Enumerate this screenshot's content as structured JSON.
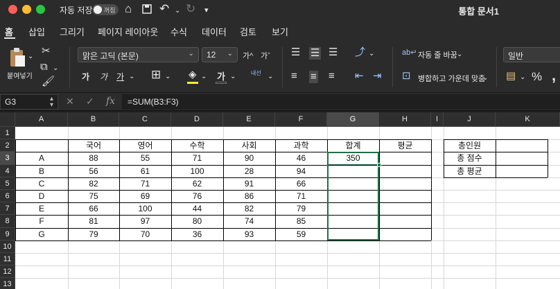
{
  "titlebar": {
    "autosave_label": "자동 저장",
    "autosave_state": "꺼짐",
    "doc_title": "통합 문서1"
  },
  "tabs": [
    "홈",
    "삽입",
    "그리기",
    "페이지 레이아웃",
    "수식",
    "데이터",
    "검토",
    "보기"
  ],
  "ribbon": {
    "paste_label": "붙여넣기",
    "font_name": "맑은 고딕 (본문)",
    "font_size": "12",
    "bold": "가",
    "italic": "가",
    "underline": "가",
    "font_color_glyph": "가",
    "grow_font": "가^",
    "shrink_font": "가ˇ",
    "rtl_label": "내선",
    "wrap_text": "자동 줄 바꿈",
    "merge_center": "병합하고 가운데 맞춤",
    "number_format": "일반",
    "percent": "%"
  },
  "formula_bar": {
    "name_box": "G3",
    "fx": "fx",
    "formula": "=SUM(B3:F3)"
  },
  "sheet": {
    "columns": [
      "A",
      "B",
      "C",
      "D",
      "E",
      "F",
      "G",
      "H",
      "I",
      "J",
      "K"
    ],
    "rows": [
      "1",
      "2",
      "3",
      "4",
      "5",
      "6",
      "7",
      "8",
      "9",
      "10",
      "11",
      "12",
      "13"
    ],
    "selected_column": "G",
    "selected_row": "3",
    "header_row": [
      "",
      "국어",
      "영어",
      "수학",
      "사회",
      "과학",
      "합계",
      "평균"
    ],
    "data": [
      [
        "A",
        "88",
        "55",
        "71",
        "90",
        "46",
        "350",
        ""
      ],
      [
        "B",
        "56",
        "61",
        "100",
        "28",
        "94",
        "",
        ""
      ],
      [
        "C",
        "82",
        "71",
        "62",
        "91",
        "66",
        "",
        ""
      ],
      [
        "D",
        "75",
        "69",
        "76",
        "86",
        "71",
        "",
        ""
      ],
      [
        "E",
        "66",
        "100",
        "44",
        "82",
        "79",
        "",
        ""
      ],
      [
        "F",
        "81",
        "97",
        "80",
        "74",
        "85",
        "",
        ""
      ],
      [
        "G",
        "79",
        "70",
        "36",
        "93",
        "59",
        "",
        ""
      ]
    ],
    "summary_labels": [
      "총인원",
      "총 점수",
      "총 평균"
    ]
  },
  "colors": {
    "selection": "#1e7145",
    "ribbon_bg": "#2b2b2b",
    "header_bg": "#2f2f2f"
  }
}
